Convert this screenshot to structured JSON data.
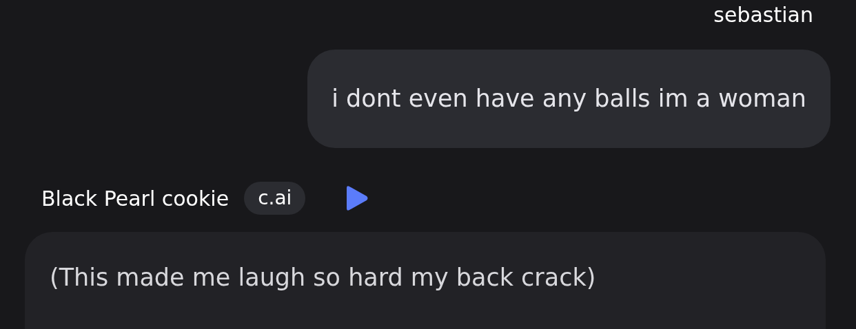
{
  "messages": [
    {
      "kind": "user",
      "author": "sebastian",
      "text": "i dont even have any balls im a woman"
    },
    {
      "kind": "bot",
      "author": "Black Pearl cookie",
      "badge": "c.ai",
      "text": "(This made me laugh so hard my back crack)"
    }
  ]
}
